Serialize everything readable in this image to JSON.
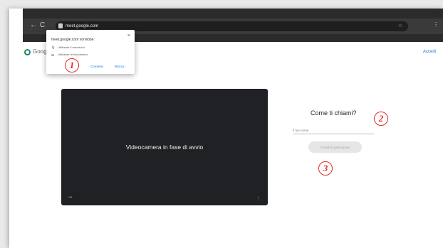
{
  "browser": {
    "back_icon": "←",
    "reload_icon": "C",
    "url": "meet.google.com",
    "bookmark_icon": "☆",
    "menu_icon": "⋮"
  },
  "page": {
    "logo_text": "Goog",
    "sign_in": "Accedi"
  },
  "permission_popup": {
    "title": "meet.google.com vorrebbe:",
    "close_icon": "×",
    "rows": [
      {
        "icon": "🎙",
        "label": "Utilizzare il microfono"
      },
      {
        "icon": "▬",
        "label": "Utilizzare la fotocamera"
      }
    ],
    "allow_label": "Consenti",
    "block_label": "Blocca"
  },
  "video": {
    "status_message": "Videocamera in fase di avvio",
    "dots": "•••",
    "more_icon": "⋮"
  },
  "join": {
    "heading": "Come ti chiami?",
    "name_placeholder": "Il tuo nome",
    "name_value": "",
    "button_label": "Chiedi di partecipare"
  },
  "callouts": [
    "1",
    "2",
    "3"
  ],
  "colors": {
    "callout": "#e02b2b",
    "link": "#1a73e8",
    "video_bg": "#202124",
    "browser_bar": "#2b2b2b"
  }
}
